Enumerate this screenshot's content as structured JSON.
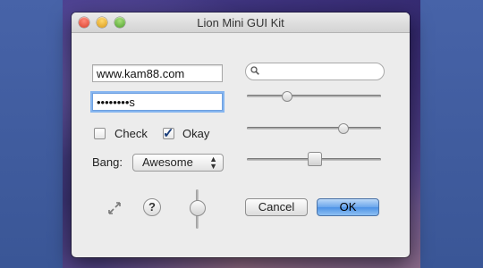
{
  "window": {
    "title": "Lion Mini GUI Kit"
  },
  "form": {
    "url_value": "www.kam88.com",
    "password_value": "••••••••s",
    "search_placeholder": "",
    "check_label": "Check",
    "check_checked": false,
    "okay_label": "Okay",
    "okay_checked": true,
    "bang_label": "Bang:",
    "bang_selected": "Awesome"
  },
  "sliders": {
    "slider1_value": 0.3,
    "slider2_value": 0.74,
    "slider3_value": 0.5,
    "vertical_value": 0.5
  },
  "buttons": {
    "cancel_label": "Cancel",
    "ok_label": "OK",
    "help_label": "?"
  },
  "icons": {
    "search": "magnifier-icon",
    "resize": "resize-arrows-icon"
  },
  "colors": {
    "ok_button": "#4d92e6",
    "focus_ring": "#86b6f0",
    "window_bg": "#ececec"
  }
}
